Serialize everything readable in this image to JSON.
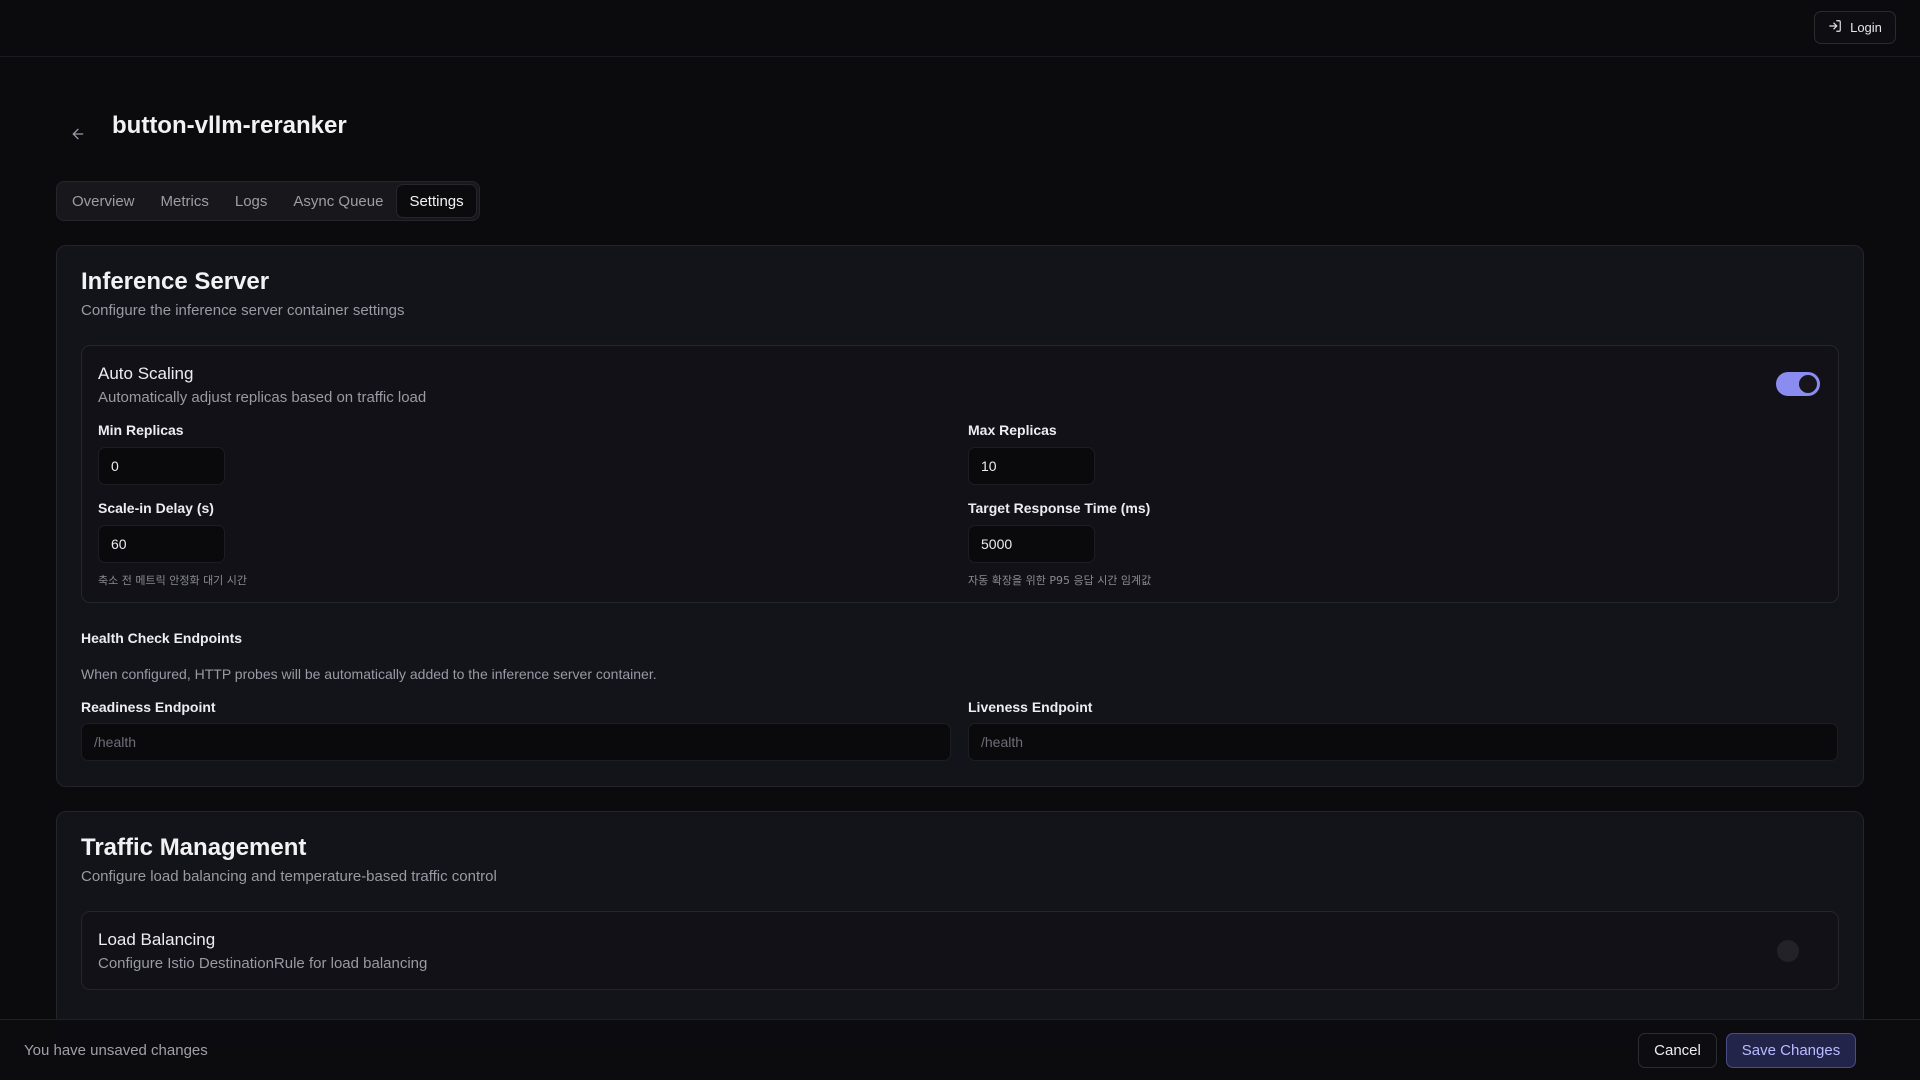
{
  "header": {
    "login_label": "Login",
    "login_icon": "login-icon"
  },
  "page": {
    "back_icon": "arrow-left-icon",
    "title": "button-vllm-reranker"
  },
  "tabs": [
    {
      "label": "Overview",
      "active": false
    },
    {
      "label": "Metrics",
      "active": false
    },
    {
      "label": "Logs",
      "active": false
    },
    {
      "label": "Async Queue",
      "active": false
    },
    {
      "label": "Settings",
      "active": true
    }
  ],
  "inference": {
    "title": "Inference Server",
    "subtitle": "Configure the inference server container settings",
    "autoscaling": {
      "title": "Auto Scaling",
      "subtitle": "Automatically adjust replicas based on traffic load",
      "enabled": true,
      "min_replicas_label": "Min Replicas",
      "min_replicas_value": "0",
      "max_replicas_label": "Max Replicas",
      "max_replicas_value": "10",
      "scale_in_label": "Scale-in Delay (s)",
      "scale_in_value": "60",
      "scale_in_hint": "축소 전 메트릭 안정화 대기 시간",
      "target_rt_label": "Target Response Time (ms)",
      "target_rt_value": "5000",
      "target_rt_hint": "자동 확장을 위한 P95 응답 시간 임계값"
    },
    "health": {
      "title": "Health Check Endpoints",
      "description": "When configured, HTTP probes will be automatically added to the inference server container.",
      "readiness_label": "Readiness Endpoint",
      "readiness_placeholder": "/health",
      "liveness_label": "Liveness Endpoint",
      "liveness_placeholder": "/health"
    }
  },
  "traffic": {
    "title": "Traffic Management",
    "subtitle": "Configure load balancing and temperature-based traffic control",
    "load_balancing": {
      "title": "Load Balancing",
      "subtitle": "Configure Istio DestinationRule for load balancing",
      "enabled": false
    }
  },
  "footer": {
    "message": "You have unsaved changes",
    "cancel_label": "Cancel",
    "save_label": "Save Changes"
  },
  "colors": {
    "accent": "#8b8cf0",
    "background": "#0b0b0e",
    "card": "#13131a"
  }
}
